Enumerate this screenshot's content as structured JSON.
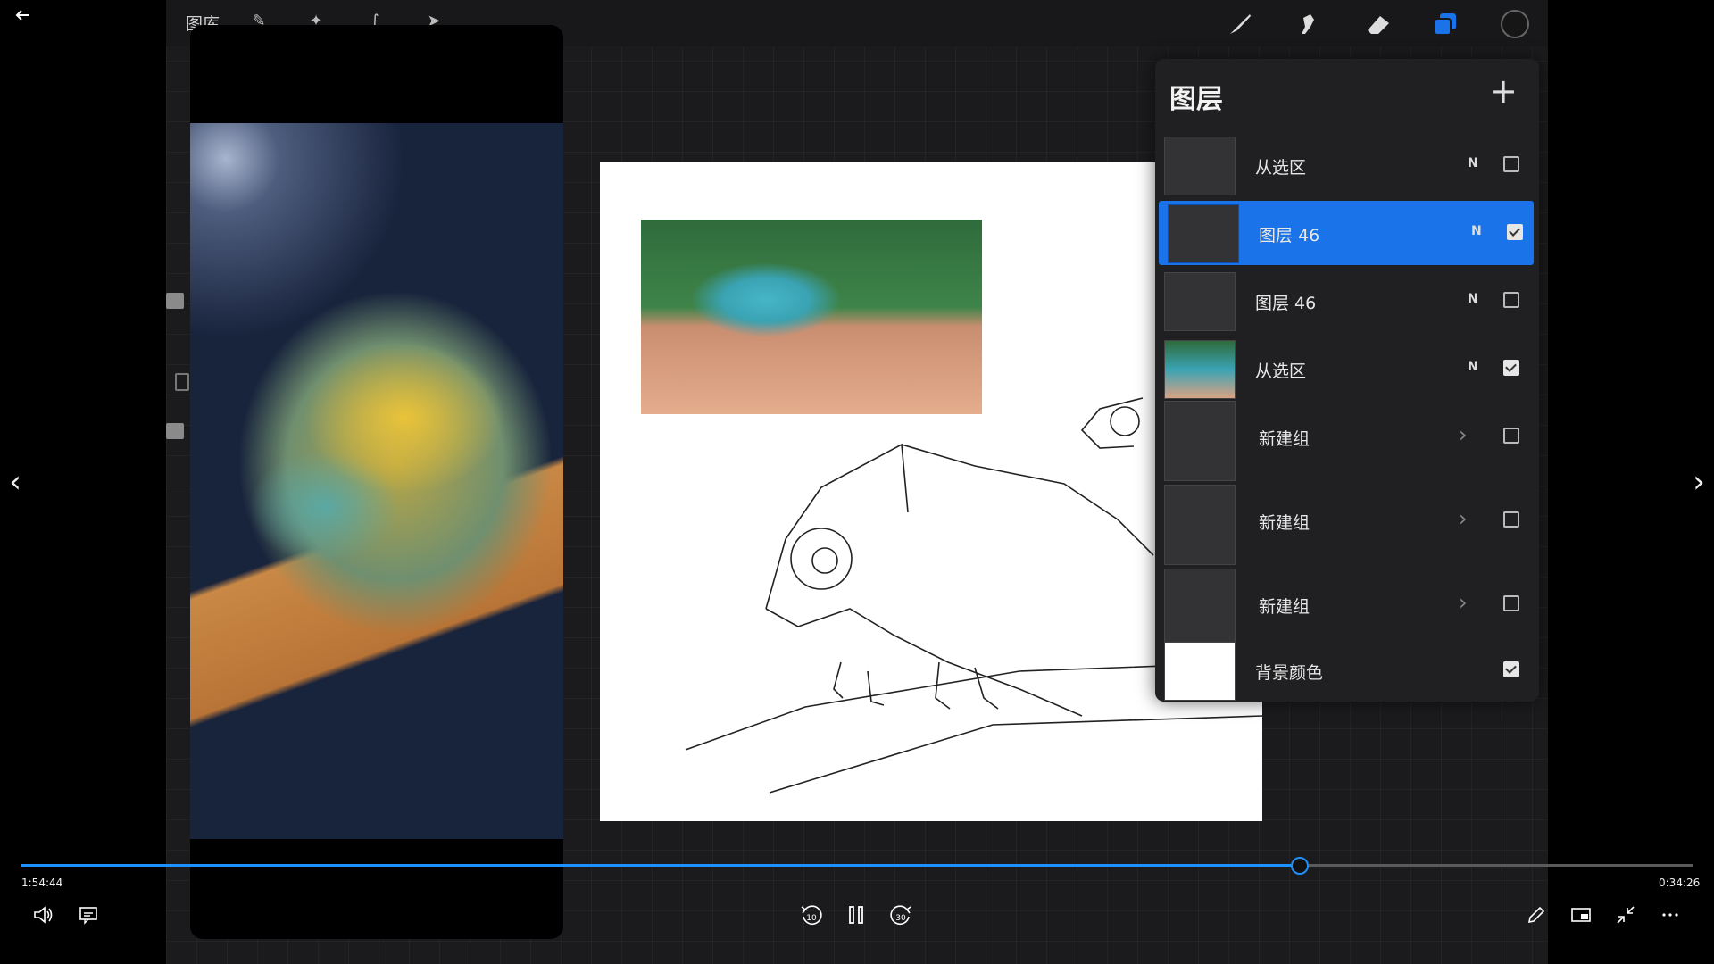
{
  "player": {
    "back_icon": "back-arrow-icon",
    "current_time": "1:54:44",
    "total_time": "0:34:26",
    "progress": 0.765,
    "skip_back_label": "10",
    "skip_forward_label": "30"
  },
  "procreate": {
    "gallery_label": "图库",
    "layers_title": "图层",
    "add_symbol": "+",
    "layers": [
      {
        "name": "从选区",
        "mode": "N",
        "checked": false,
        "selected": false,
        "type": "layer"
      },
      {
        "name": "图层 46",
        "mode": "N",
        "checked": true,
        "selected": true,
        "type": "layer"
      },
      {
        "name": "图层 46",
        "mode": "N",
        "checked": false,
        "selected": false,
        "type": "layer"
      },
      {
        "name": "从选区",
        "mode": "N",
        "checked": true,
        "selected": false,
        "type": "layer"
      },
      {
        "name": "新建组",
        "mode": "",
        "checked": false,
        "selected": false,
        "type": "group"
      },
      {
        "name": "新建组",
        "mode": "",
        "checked": false,
        "selected": false,
        "type": "group"
      },
      {
        "name": "新建组",
        "mode": "",
        "checked": false,
        "selected": false,
        "type": "group"
      },
      {
        "name": "背景颜色",
        "mode": "",
        "checked": true,
        "selected": false,
        "type": "background"
      }
    ],
    "colors": {
      "accent": "#1a73e8",
      "panel": "#202022"
    }
  }
}
